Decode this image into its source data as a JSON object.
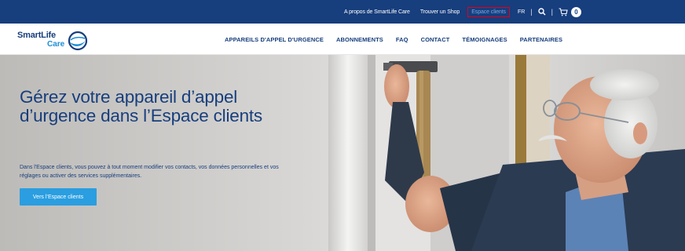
{
  "topbar": {
    "links": [
      "A propos de SmartLife Care",
      "Trouver un Shop"
    ],
    "espace_clients": "Espace clients",
    "language": "FR",
    "cart_count": "0"
  },
  "logo": {
    "line1": "SmartLife",
    "line2": "Care"
  },
  "nav": {
    "items": [
      "APPAREILS D'APPEL D'URGENCE",
      "ABONNEMENTS",
      "FAQ",
      "CONTACT",
      "TÉMOIGNAGES",
      "PARTENAIRES"
    ]
  },
  "hero": {
    "title": "Gérez votre appareil d’appel d’urgence dans l’Espace clients",
    "text": "Dans l'Espace clients, vous pouvez à tout moment modifier vos contacts, vos données personnelles et vos réglages ou activer des services supplémentaires.",
    "button": "Vers l’Espace clients"
  },
  "colors": {
    "brand_dark": "#173e7d",
    "brand_light": "#2a9ee0",
    "highlight": "#e1001a"
  }
}
